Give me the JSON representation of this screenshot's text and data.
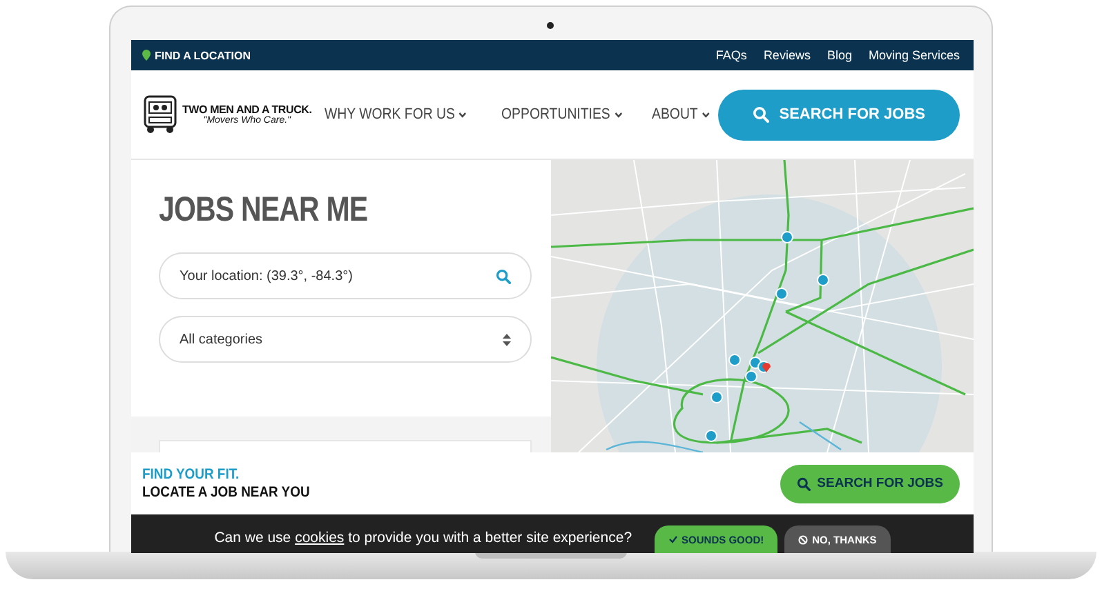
{
  "top_bar": {
    "location_link": "FIND A LOCATION",
    "links": [
      "FAQs",
      "Reviews",
      "Blog",
      "Moving Services"
    ]
  },
  "header": {
    "logo": {
      "name": "TWO MEN AND A TRUCK.",
      "tagline": "\"Movers Who Care.\""
    },
    "nav": [
      {
        "label": "WHY WORK FOR US",
        "has_menu": true
      },
      {
        "label": "OPPORTUNITIES",
        "has_menu": true
      },
      {
        "label": "ABOUT",
        "has_menu": true
      }
    ],
    "search_button": "SEARCH FOR JOBS"
  },
  "jobs_panel": {
    "title": "JOBS NEAR ME",
    "location_field": {
      "value": "Your location: (39.3°, -84.3°)"
    },
    "category_select": {
      "value": "All categories"
    }
  },
  "cta": {
    "eyebrow": "FIND YOUR FIT.",
    "heading": "LOCATE A JOB NEAR YOU",
    "button": "SEARCH FOR JOBS"
  },
  "cookie_banner": {
    "text_before": "Can we use ",
    "link": "cookies",
    "text_after": " to provide you with a better site experience?",
    "accept": "SOUNDS GOOD!",
    "decline": "NO, THANKS"
  }
}
